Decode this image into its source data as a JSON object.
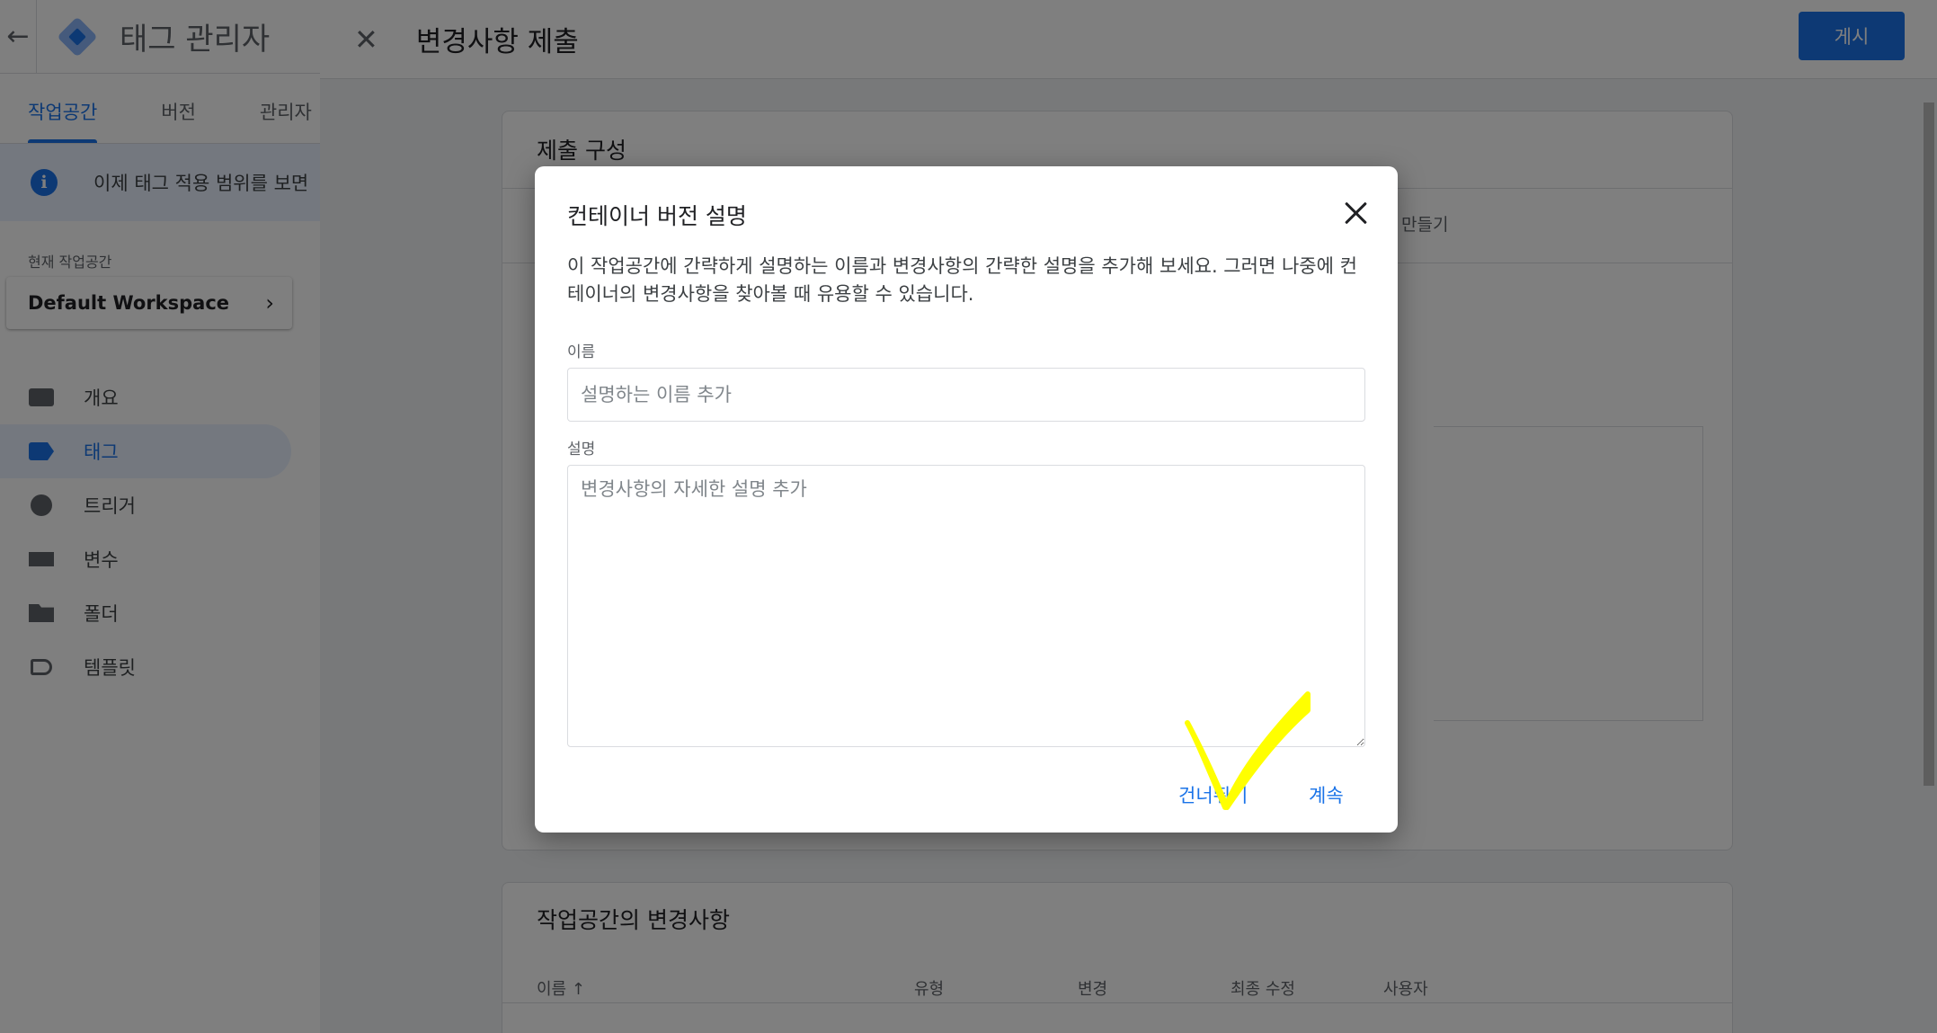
{
  "app": {
    "title": "태그 관리자",
    "tabs": [
      {
        "label": "작업공간",
        "active": true
      },
      {
        "label": "버전",
        "active": false
      },
      {
        "label": "관리자",
        "active": false
      }
    ],
    "notice": "이제 태그 적용 범위를 보면",
    "workspace_label": "현재 작업공간",
    "workspace_name": "Default Workspace",
    "nav": [
      {
        "label": "개요",
        "icon": "overview-icon",
        "active": false
      },
      {
        "label": "태그",
        "icon": "tag-icon",
        "active": true
      },
      {
        "label": "트리거",
        "icon": "trigger-icon",
        "active": false
      },
      {
        "label": "변수",
        "icon": "variable-icon",
        "active": false
      },
      {
        "label": "폴더",
        "icon": "folder-icon",
        "active": false
      },
      {
        "label": "템플릿",
        "icon": "template-icon",
        "active": false
      }
    ]
  },
  "panel": {
    "title": "변경사항 제출",
    "publish_label": "게시",
    "card1_title": "제출 구성",
    "card1_strip_text": "만들기",
    "card2_title": "작업공간의 변경사항",
    "columns": [
      "이름 ↑",
      "유형",
      "변경",
      "최종 수정",
      "사용자"
    ]
  },
  "dialog": {
    "title": "컨테이너 버전 설명",
    "description": "이 작업공간에 간략하게 설명하는 이름과 변경사항의 간략한 설명을 추가해 보세요. 그러면 나중에 컨테이너의 변경사항을 찾아볼 때 유용할 수 있습니다.",
    "name_label": "이름",
    "name_placeholder": "설명하는 이름 추가",
    "name_value": "",
    "desc_label": "설명",
    "desc_placeholder": "변경사항의 자세한 설명 추가",
    "desc_value": "",
    "skip_label": "건너뛰기",
    "continue_label": "계속"
  },
  "colors": {
    "accent": "#1a73e8",
    "annotation": "#ffff00"
  }
}
